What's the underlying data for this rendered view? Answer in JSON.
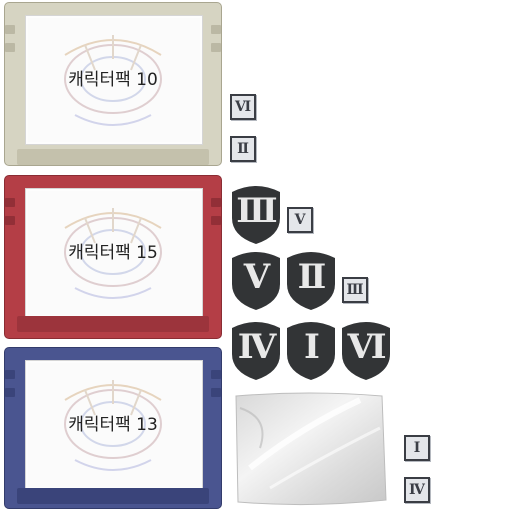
{
  "cartridges": [
    {
      "title": "캐릭터팩 10",
      "body": "#d4d2c0",
      "dark": "#bdbaa6"
    },
    {
      "title": "캐릭터팩 15",
      "body": "#b84048",
      "dark": "#9a3038"
    },
    {
      "title": "캐릭터팩 13",
      "body": "#4a5590",
      "dark": "#3a447a"
    }
  ],
  "badges": {
    "b1": "Ⅵ",
    "b2": "Ⅱ",
    "b3": "Ⅴ",
    "b4": "Ⅲ",
    "b5": "Ⅰ",
    "b6": "Ⅳ"
  },
  "shields": {
    "s1": "Ⅲ",
    "s2": "Ⅴ",
    "s3": "Ⅱ",
    "s4": "Ⅳ",
    "s5": "Ⅰ",
    "s6": "Ⅵ"
  },
  "colors": {
    "shield": "#323436",
    "badge_bg": "#e4e6ea",
    "bag": "#e6e6e6"
  }
}
